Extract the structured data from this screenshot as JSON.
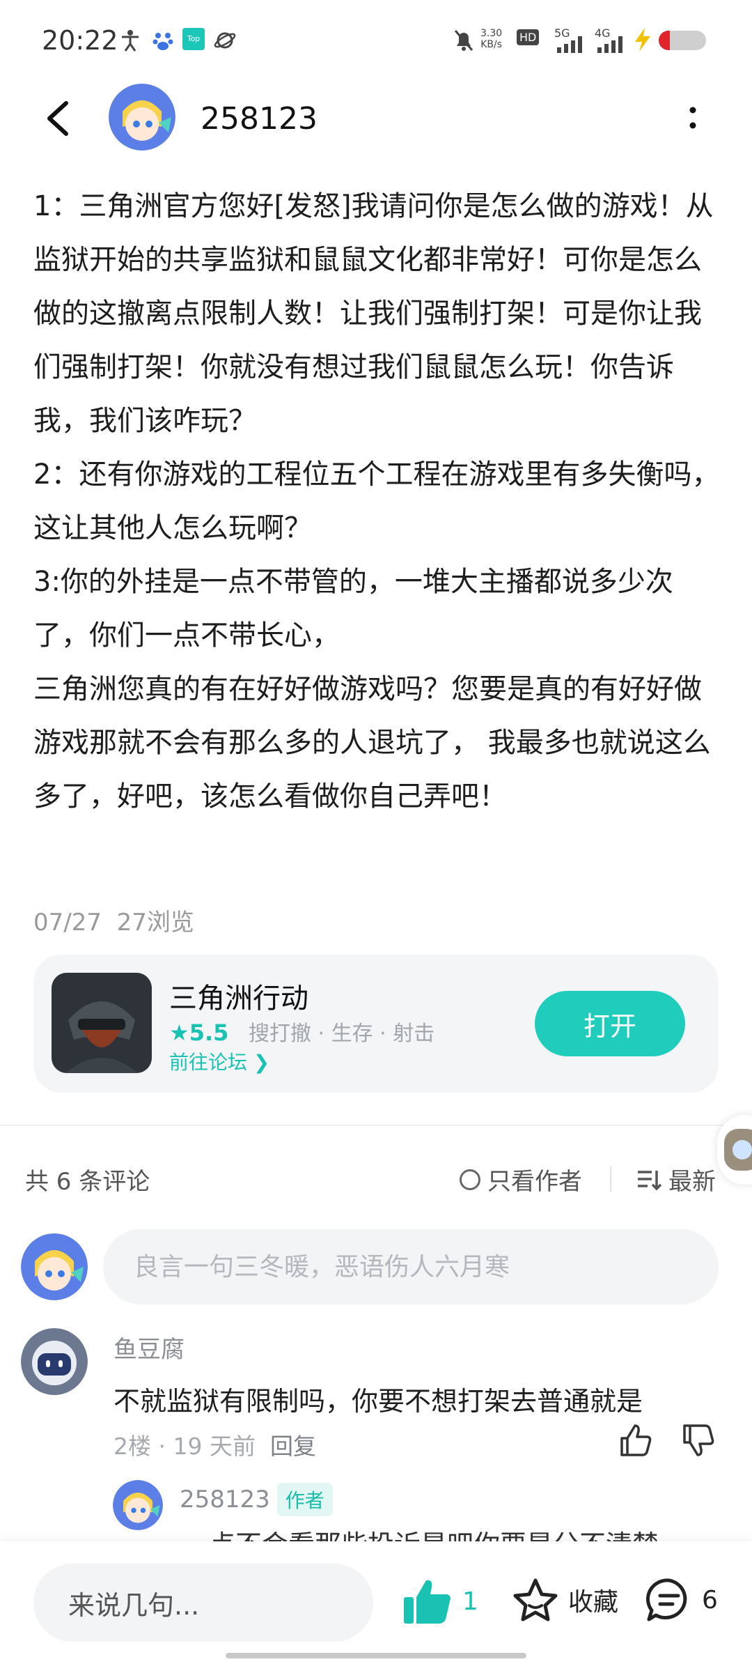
{
  "status_bar": {
    "time": "20:22",
    "net_speed_value": "3.30",
    "net_speed_unit": "KB/s",
    "hd_label": "HD",
    "sim1_network": "5G",
    "sim2_network": "4G"
  },
  "header": {
    "username": "258123"
  },
  "post": {
    "paragraphs": [
      "1：三角洲官方您好[发怒]我请问你是怎么做的游戏！从监狱开始的共享监狱和鼠鼠文化都非常好！可你是怎么做的这撤离点限制人数！让我们强制打架！可是你让我们强制打架！你就没有想过我们鼠鼠怎么玩！你告诉我，我们该咋玩？",
      " 2：还有你游戏的工程位五个工程在游戏里有多失衡吗，这让其他人怎么玩啊？",
      "3:你的外挂是一点不带管的，一堆大主播都说多少次了，你们一点不带长心，",
      "三角洲您真的有在好好做游戏吗？您要是真的有好好做游戏那就不会有那么多的人退坑了，  我最多也就说这么多了，好吧，该怎么看做你自己弄吧！"
    ],
    "date": "07/27",
    "views": "27浏览"
  },
  "game_card": {
    "name": "三角洲行动",
    "rating": "5.5",
    "tags": [
      "搜打撤",
      "生存",
      "射击"
    ],
    "forum_link": "前往论坛",
    "open_button": "打开"
  },
  "comments": {
    "count_label": "共 6 条评论",
    "author_only": "只看作者",
    "sort_label": "最新",
    "input_placeholder": "良言一句三冬暖，恶语伤人六月寒",
    "items": [
      {
        "name": "鱼豆腐",
        "text": "不就监狱有限制吗，你要不想打架去普通就是",
        "floor": "2楼",
        "time": "19 天前",
        "reply_label": "回复"
      }
    ],
    "reply": {
      "name": "258123",
      "tag": "作者",
      "text": "点不会看那些投诉是吧你要是分不清楚"
    }
  },
  "bottom_bar": {
    "say_placeholder": "来说几句...",
    "like_count": "1",
    "favorite_label": "收藏",
    "comment_count": "6"
  },
  "colors": {
    "accent": "#20cdbd",
    "rating_star": "#19c2b3"
  }
}
